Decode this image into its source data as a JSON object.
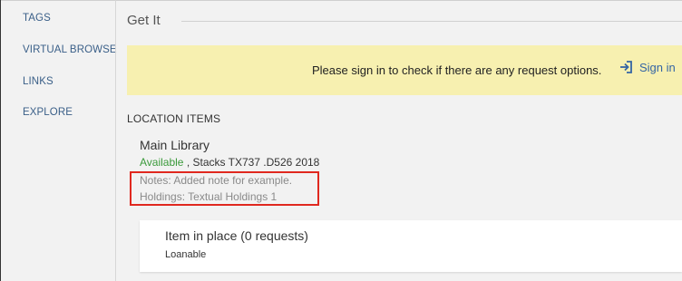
{
  "sidebar": {
    "items": [
      {
        "label": "TAGS"
      },
      {
        "label": "VIRTUAL BROWSE"
      },
      {
        "label": "LINKS"
      },
      {
        "label": "EXPLORE"
      }
    ]
  },
  "section": {
    "title": "Get It"
  },
  "banner": {
    "message": "Please sign in to check if there are any request options.",
    "signin_label": "Sign in",
    "signin_icon": "sign-in-icon"
  },
  "location": {
    "header": "LOCATION ITEMS",
    "library": "Main Library",
    "status": "Available",
    "call_info": " , Stacks TX737 .D526 2018",
    "notes": "Notes: Added note for example.",
    "holdings": "Holdings: Textual Holdings 1"
  },
  "item": {
    "title": "Item in place (0 requests)",
    "policy": "Loanable"
  },
  "colors": {
    "link": "#3465a4",
    "available": "#3b9a3b",
    "banner_bg": "#f7f0b0",
    "highlight": "#e0281f"
  }
}
